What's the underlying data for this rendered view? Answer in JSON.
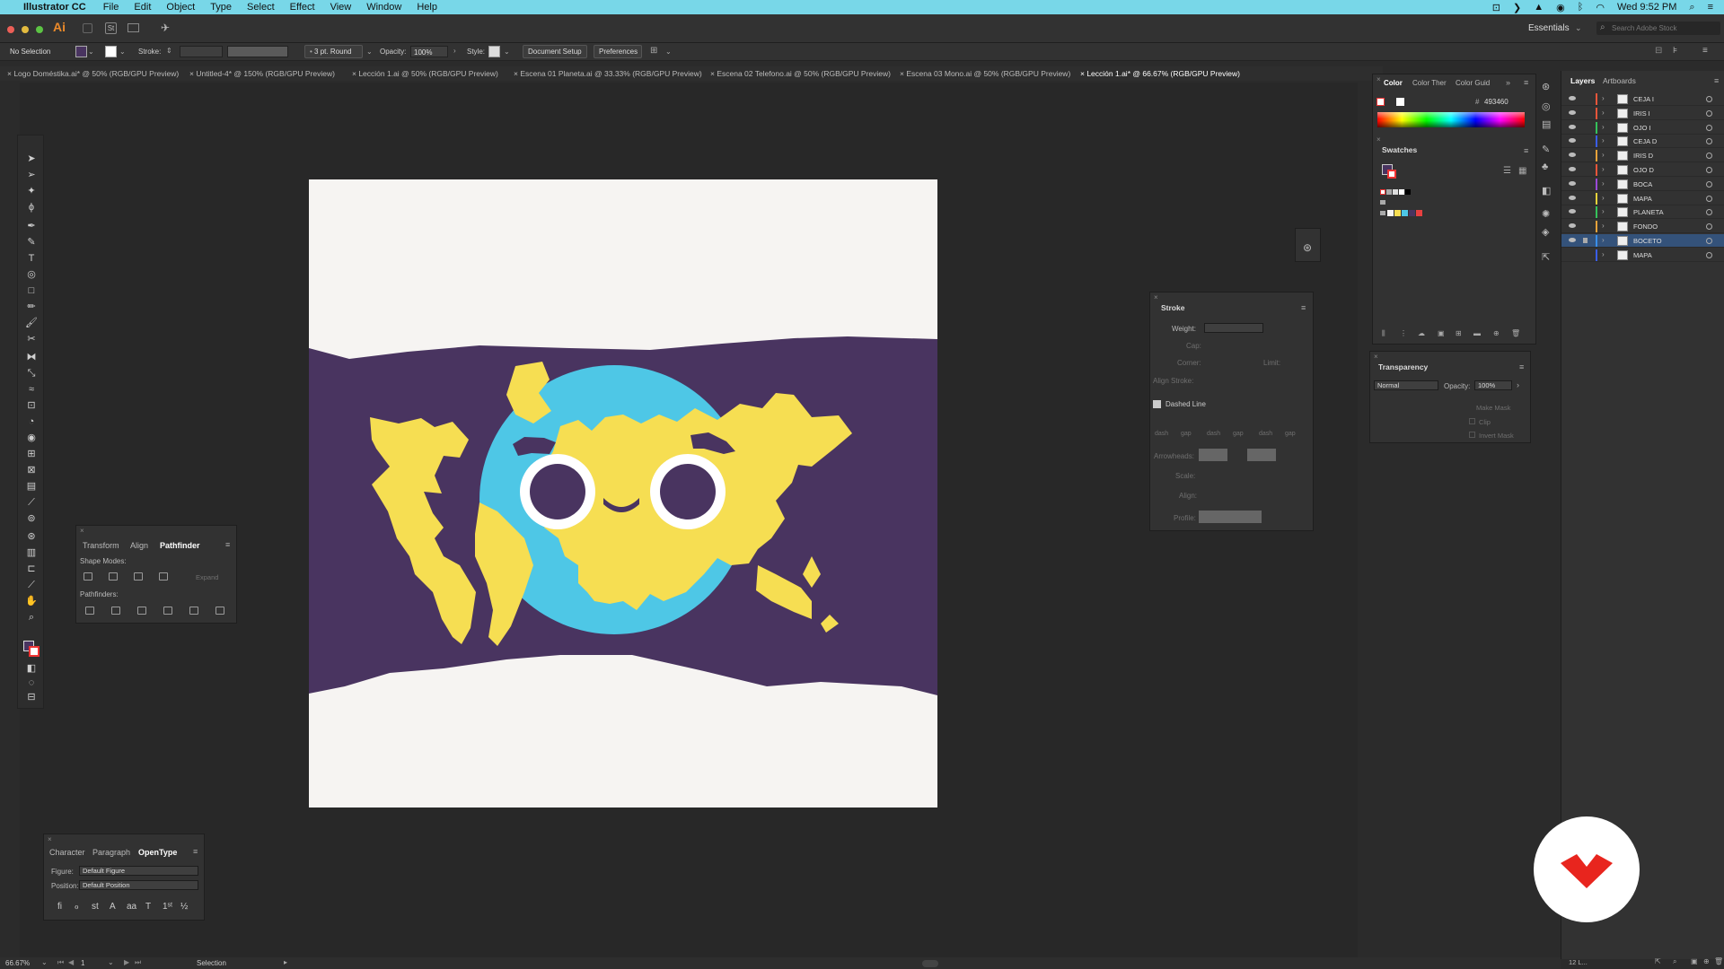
{
  "menubar": {
    "app_name": "Illustrator CC",
    "items": [
      "File",
      "Edit",
      "Object",
      "Type",
      "Select",
      "Effect",
      "View",
      "Window",
      "Help"
    ],
    "clock": "Wed 9:52 PM"
  },
  "appbar": {
    "app_logo": "Ai",
    "workspace": "Essentials",
    "search_placeholder": "Search Adobe Stock"
  },
  "control_bar": {
    "selection_label": "No Selection",
    "stroke_label": "Stroke:",
    "brush_label": "3 pt. Round",
    "opacity_label": "Opacity:",
    "opacity_value": "100%",
    "style_label": "Style:",
    "document_setup": "Document Setup",
    "preferences": "Preferences"
  },
  "tabs": [
    {
      "label": "Logo Doméstika.ai* @ 50% (RGB/GPU Preview)"
    },
    {
      "label": "Untitled-4* @ 150% (RGB/GPU Preview)"
    },
    {
      "label": "Lección 1.ai @ 50% (RGB/GPU Preview)"
    },
    {
      "label": "Escena 01 Planeta.ai @ 33.33% (RGB/GPU Preview)"
    },
    {
      "label": "Escena 02 Telefono.ai @ 50% (RGB/GPU Preview)"
    },
    {
      "label": "Escena 03 Mono.ai @ 50% (RGB/GPU Preview)"
    },
    {
      "label": "Lección 1.ai* @ 66.67% (RGB/GPU Preview)"
    }
  ],
  "pathfinder_panel": {
    "tabs": [
      "Transform",
      "Align",
      "Pathfinder"
    ],
    "shape_modes": "Shape Modes:",
    "expand": "Expand",
    "pathfinders": "Pathfinders:"
  },
  "character_panel": {
    "tabs": [
      "Character",
      "Paragraph",
      "OpenType"
    ],
    "figure_label": "Figure:",
    "figure_value": "Default Figure",
    "position_label": "Position:",
    "position_value": "Default Position"
  },
  "stroke_panel": {
    "title": "Stroke",
    "weight_label": "Weight:",
    "cap_label": "Cap:",
    "corner_label": "Corner:",
    "limit_label": "Limit:",
    "align_label": "Align Stroke:",
    "dashed_label": "Dashed Line",
    "dash_labels": [
      "dash",
      "gap",
      "dash",
      "gap",
      "dash",
      "gap"
    ],
    "arrowheads_label": "Arrowheads:",
    "scale_label": "Scale:",
    "align2_label": "Align:",
    "profile_label": "Profile:"
  },
  "color_panel": {
    "tabs": [
      "Color",
      "Color Ther",
      "Color Guid"
    ],
    "hex": "493460",
    "swatches_title": "Swatches"
  },
  "transparency_panel": {
    "title": "Transparency",
    "mode": "Normal",
    "opacity_label": "Opacity:",
    "opacity_value": "100%",
    "make_mask": "Make Mask",
    "clip": "Clip",
    "invert_mask": "Invert Mask"
  },
  "layers_panel": {
    "tabs": [
      "Layers",
      "Artboards"
    ],
    "layers": [
      {
        "name": "CEJA I",
        "color": "#e8553a"
      },
      {
        "name": "IRIS I",
        "color": "#e8553a"
      },
      {
        "name": "OJO I",
        "color": "#35c25b"
      },
      {
        "name": "CEJA D",
        "color": "#3a5de8"
      },
      {
        "name": "IRIS D",
        "color": "#e8a33a"
      },
      {
        "name": "OJO D",
        "color": "#e8553a"
      },
      {
        "name": "BOCA",
        "color": "#9a4ad8"
      },
      {
        "name": "MAPA",
        "color": "#e8d23a"
      },
      {
        "name": "PLANETA",
        "color": "#35c25b"
      },
      {
        "name": "FONDO",
        "color": "#e8a33a"
      },
      {
        "name": "BOCETO",
        "color": "#3a8ee8"
      },
      {
        "name": "MAPA",
        "color": "#3a5de8"
      }
    ],
    "footer": "12 L..."
  },
  "status_bar": {
    "zoom": "66.67%",
    "artboard_num": "1",
    "tool": "Selection"
  },
  "colors": {
    "accent_purple": "#493460",
    "ocean": "#4ec7e6",
    "land": "#f6de52"
  }
}
